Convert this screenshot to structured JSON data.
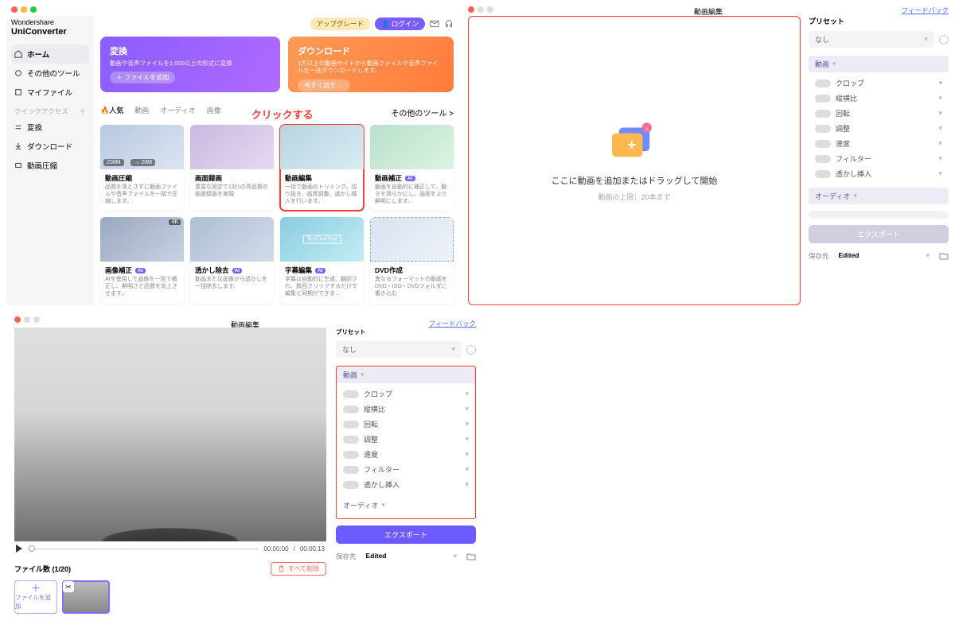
{
  "home": {
    "brand_line1": "Wondershare",
    "brand_line2": "UniConverter",
    "topbar": {
      "upgrade": "アップグレード",
      "login": "ログイン"
    },
    "nav": {
      "home": "ホーム",
      "other_tools": "その他のツール",
      "my_files": "マイファイル",
      "quick_access": "クイックアクセス",
      "convert": "変換",
      "download": "ダウンロード",
      "compress": "動画圧縮"
    },
    "hero": {
      "convert_title": "変換",
      "convert_desc": "動画や音声ファイルを1,000以上の形式に変換",
      "convert_btn": "＋ ファイルを追加",
      "download_title": "ダウンロード",
      "download_desc": "1万以上の動画サイトから動画ファイルや音声ファイルを一括ダウンロードします。",
      "download_btn": "今すぐ試す →"
    },
    "tabs": {
      "popular": "🔥人気",
      "video": "動画",
      "audio": "オーディオ",
      "image": "画像",
      "more": "その他のツール >"
    },
    "click_hint": "クリックする",
    "cards": [
      {
        "title": "動画圧縮",
        "desc": "品質を落とさずに動画ファイルや音声ファイルを一括で圧縮します。",
        "ai": false,
        "size_l": "200M",
        "size_r": "20M"
      },
      {
        "title": "画面録画",
        "desc": "豊富な設定で1対1の高品質の画面録画を実現",
        "ai": false
      },
      {
        "title": "動画編集",
        "desc": "一括で動画のトリミング、切り抜き、画質調整、透かし挿入を行います。",
        "ai": false
      },
      {
        "title": "動画補正",
        "desc": "動画を自動的に補正して、動きを滑らかにし、画面をより鮮明にします。",
        "ai": true
      },
      {
        "title": "画像補正",
        "desc": "AIを使用して画像を一括で補正し、鮮明さと品質を向上させます。",
        "ai": true,
        "topk": "4K"
      },
      {
        "title": "透かし除去",
        "desc": "動画または画像から透かしを一括除去します。",
        "ai": true
      },
      {
        "title": "字幕編集",
        "desc": "字幕は自動的に生成、翻訳され、数回クリックするだけで編集と同期ができま…",
        "ai": true,
        "ttext": "TextTextText"
      },
      {
        "title": "DVD作成",
        "desc": "異なるフォーマットの動画をDVD・ISO・DVDフォルダに書き込む",
        "ai": false
      }
    ]
  },
  "ed_empty": {
    "title": "動画編集",
    "feedback": "フィードバック",
    "drop_main": "ここに動画を追加またはドラッグして開始",
    "drop_sub": "動画の上限：20本まで",
    "preset_h": "プリセット",
    "preset_none": "なし",
    "sec_video": "動画",
    "sec_audio": "オーディオ",
    "opts": [
      "クロップ",
      "縦横比",
      "回転",
      "調整",
      "速度",
      "フィルター",
      "透かし挿入"
    ],
    "export": "エクスポート",
    "save_lbl": "保存先",
    "save_val": "Edited"
  },
  "ed_file": {
    "title": "動画編集",
    "feedback": "フィードバック",
    "time_cur": "00:00:00",
    "time_tot": "00:00:13",
    "file_count": "ファイル数 (1/20)",
    "delete_all": "すべて削除",
    "add_file": "ファイルを追加",
    "preset_h": "プリセット",
    "preset_none": "なし",
    "sec_video": "動画",
    "sec_audio": "オーディオ",
    "opts": [
      "クロップ",
      "縦横比",
      "回転",
      "調整",
      "速度",
      "フィルター",
      "透かし挿入"
    ],
    "export": "エクスポート",
    "save_lbl": "保存先",
    "save_val": "Edited"
  }
}
